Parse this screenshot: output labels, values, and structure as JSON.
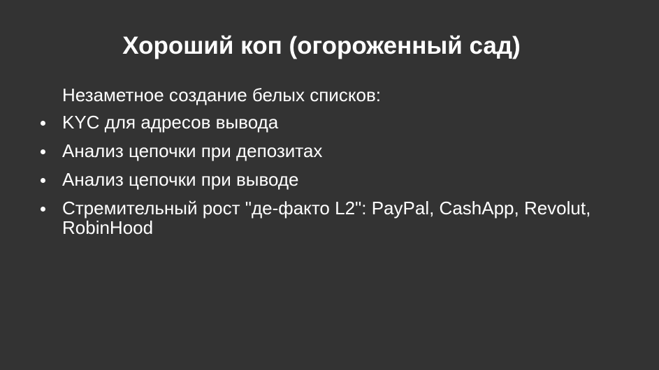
{
  "slide": {
    "title": "Хороший коп (огороженный сад)",
    "intro": "Незаметное создание белых списков:",
    "bullets": [
      "KYC для адресов вывода",
      "Анализ цепочки при депозитах",
      "Анализ цепочки при выводе",
      "Стремительный рост \"де-факто L2\": PayPal, CashApp, Revolut, RobinHood"
    ]
  },
  "colors": {
    "background": "#333333",
    "text": "#ffffff"
  }
}
